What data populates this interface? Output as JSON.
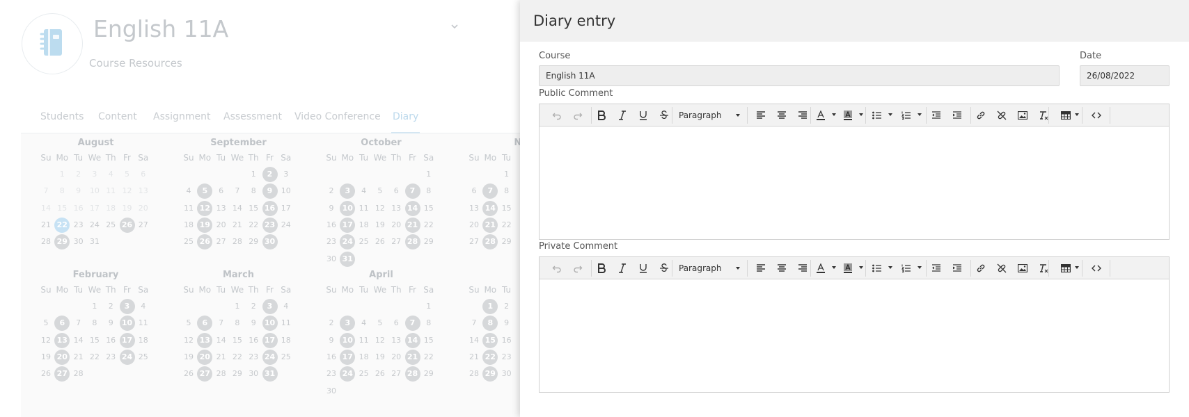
{
  "course_page": {
    "title": "English 11A",
    "subtitle": "Course Resources",
    "tabs": [
      {
        "label": "Students",
        "active": false
      },
      {
        "label": "Content",
        "active": false
      },
      {
        "label": "Assignment",
        "active": false
      },
      {
        "label": "Assessment",
        "active": false
      },
      {
        "label": "Video Conference",
        "active": false
      },
      {
        "label": "Diary",
        "active": true
      }
    ],
    "weekdays": [
      "Su",
      "Mo",
      "Tu",
      "We",
      "Th",
      "Fr",
      "Sa"
    ],
    "months": [
      {
        "name": "August",
        "first_weekday": 1,
        "days": 31,
        "faded_through": 20,
        "today": 22,
        "marked": [
          29,
          26
        ]
      },
      {
        "name": "September",
        "first_weekday": 4,
        "days": 30,
        "marked": [
          2,
          5,
          9,
          12,
          16,
          19,
          23,
          26,
          30
        ]
      },
      {
        "name": "October",
        "first_weekday": 6,
        "days": 31,
        "marked": [
          3,
          7,
          10,
          14,
          17,
          21,
          24,
          28,
          31
        ]
      },
      {
        "name": "Nov",
        "first_weekday": 2,
        "days": 30,
        "visible_columns": 3,
        "marked": [
          7,
          14,
          21,
          28
        ]
      },
      {
        "name": "February",
        "first_weekday": 3,
        "days": 28,
        "marked": [
          3,
          6,
          10,
          13,
          17,
          20,
          24,
          27
        ]
      },
      {
        "name": "March",
        "first_weekday": 3,
        "days": 31,
        "marked": [
          3,
          6,
          10,
          13,
          17,
          20,
          24,
          27,
          31
        ]
      },
      {
        "name": "April",
        "first_weekday": 6,
        "days": 30,
        "marked": [
          3,
          7,
          10,
          14,
          17,
          21,
          24,
          28
        ]
      },
      {
        "name": "M",
        "first_weekday": 1,
        "days": 31,
        "visible_columns": 3,
        "marked": [
          1,
          8,
          15,
          22,
          29
        ]
      }
    ]
  },
  "dialog": {
    "title": "Diary entry",
    "course_label": "Course",
    "course_value": "English 11A",
    "date_label": "Date",
    "date_value": "26/08/2022",
    "public_comment_label": "Public Comment",
    "private_comment_label": "Private Comment",
    "public_comment_value": "",
    "private_comment_value": "",
    "format_select_value": "Paragraph"
  },
  "toolbar_icons": [
    "undo-icon",
    "redo-icon",
    "bold-icon",
    "italic-icon",
    "underline-icon",
    "strikethrough-icon",
    "paragraph-format-select",
    "align-left-icon",
    "align-center-icon",
    "align-right-icon",
    "text-color-icon",
    "background-color-icon",
    "bullet-list-icon",
    "numbered-list-icon",
    "outdent-icon",
    "indent-icon",
    "link-icon",
    "unlink-icon",
    "image-icon",
    "clear-formatting-icon",
    "table-icon",
    "source-code-icon"
  ],
  "colors": {
    "dialog_header_bg": "#f1f1f1",
    "toolbar_bg": "#f2f2f2",
    "marked_day_bg": "#d6d8da",
    "today_bg": "#c7e2f4",
    "active_tab": "#bcd9ec",
    "course_icon": "#bcdcef"
  }
}
